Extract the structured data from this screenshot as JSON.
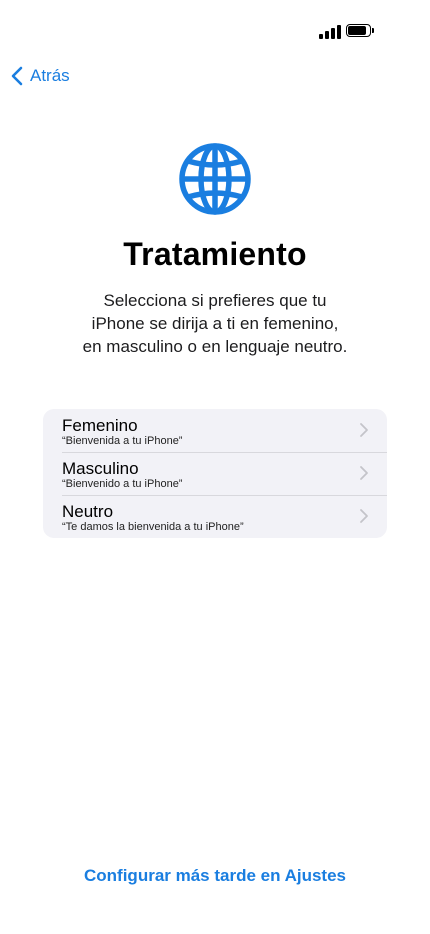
{
  "status_bar": {
    "signal_icon": "cellular-signal-icon",
    "battery_icon": "battery-icon"
  },
  "nav": {
    "back_label": "Atrás",
    "back_icon": "chevron-left-icon"
  },
  "header": {
    "icon": "globe-icon",
    "title": "Tratamiento",
    "subtitle": "Selecciona si prefieres que tu\niPhone se dirija a ti en femenino,\nen masculino o en lenguaje neutro."
  },
  "options": [
    {
      "label": "Femenino",
      "example": "“Bienvenida a tu iPhone”"
    },
    {
      "label": "Masculino",
      "example": "“Bienvenido a tu iPhone”"
    },
    {
      "label": "Neutro",
      "example": "“Te damos la bienvenida a tu iPhone”"
    }
  ],
  "footer": {
    "link_label": "Configurar más tarde en Ajustes"
  },
  "colors": {
    "accent": "#1a7ee0",
    "list_background": "#f2f2f7"
  }
}
